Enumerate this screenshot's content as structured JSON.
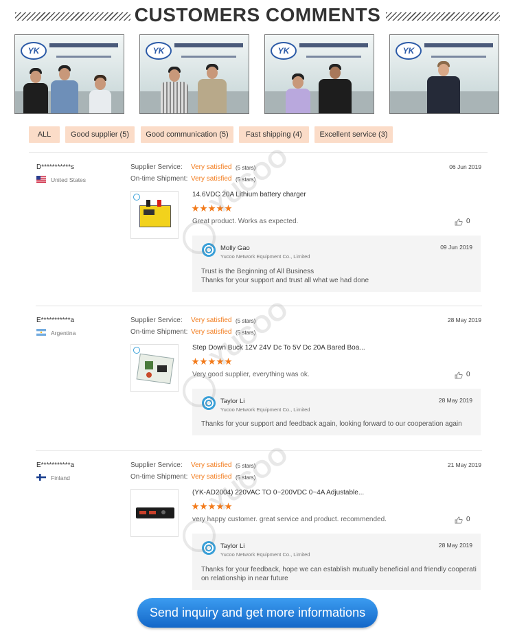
{
  "header": {
    "title": "CUSTOMERS COMMENTS"
  },
  "photos": [
    {
      "logo": "YK"
    },
    {
      "logo": "YK"
    },
    {
      "logo": "YK"
    },
    {
      "logo": "YK"
    }
  ],
  "filters": [
    {
      "label": "ALL"
    },
    {
      "label": "Good supplier (5)"
    },
    {
      "label": "Good communication (5)"
    },
    {
      "label": "Fast shipping (4)"
    },
    {
      "label": "Excellent service (3)"
    }
  ],
  "review_labels": {
    "supplier_service": "Supplier Service:",
    "ontime_shipment": "On-time Shipment:"
  },
  "reviews": [
    {
      "buyer": "D***********s",
      "country": "United States",
      "date": "06 Jun 2019",
      "supplier_rating": "Very satisfied",
      "supplier_stars": "(5 stars)",
      "shipment_rating": "Very satisfied",
      "shipment_stars": "(5 stars)",
      "product": "14.6VDC 20A Lithium battery charger",
      "rating": 5,
      "comment": "Great product. Works as expected.",
      "likes": "0",
      "reply": {
        "staff": "Molly Gao",
        "company": "Yucoo Network Equipment Co., Limited",
        "date": "09 Jun 2019",
        "line1": "Trust is the Beginning of All Business",
        "line2": "Thanks for your support and trust all what we had done"
      }
    },
    {
      "buyer": "E***********a",
      "country": "Argentina",
      "date": "28 May 2019",
      "supplier_rating": "Very satisfied",
      "supplier_stars": "(5 stars)",
      "shipment_rating": "Very satisfied",
      "shipment_stars": "(5 stars)",
      "product": "Step Down Buck 12V 24V Dc To 5V Dc 20A Bared Boa...",
      "rating": 5,
      "comment": "Very good supplier, everything was ok.",
      "likes": "0",
      "reply": {
        "staff": "Taylor Li",
        "company": "Yucoo Network Equipment Co., Limited",
        "date": "28 May 2019",
        "line1": "Thanks for your support and feedback again, looking forward to our cooperation again"
      }
    },
    {
      "buyer": "E***********a",
      "country": "Finland",
      "date": "21 May 2019",
      "supplier_rating": "Very satisfied",
      "supplier_stars": "(5 stars)",
      "shipment_rating": "Very satisfied",
      "shipment_stars": "(5 stars)",
      "product": "(YK-AD2004) 220VAC TO 0~200VDC 0~4A Adjustable...",
      "rating": 5,
      "comment": "very happy customer. great service and product. recommended.",
      "likes": "0",
      "reply": {
        "staff": "Taylor Li",
        "company": "Yucoo Network Equipment Co., Limited",
        "date": "28 May 2019",
        "line1": "Thanks for your feedback, hope we can establish mutually beneficial and friendly cooperati",
        "line2": "on relationship in near future"
      }
    }
  ],
  "watermark": {
    "text": "YUCOO"
  },
  "cta": {
    "label": "Send inquiry and get more informations"
  },
  "colors": {
    "accent": "#f27a1a",
    "tab_bg": "#fbdcc8",
    "cta": "#1e7ee0"
  }
}
